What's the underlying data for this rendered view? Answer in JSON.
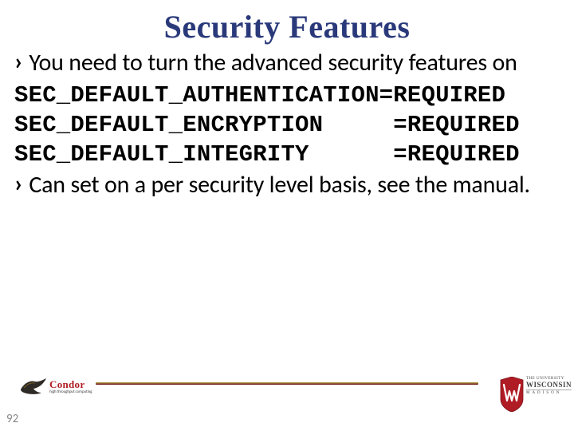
{
  "title": "Security Features",
  "bullets": [
    "You need to turn the advanced security features on",
    "Can set on a per security level basis, see the manual."
  ],
  "code": {
    "l1": "SEC_DEFAULT_AUTHENTICATION=REQUIRED",
    "l2": "SEC_DEFAULT_ENCRYPTION     =REQUIRED",
    "l3": "SEC_DEFAULT_INTEGRITY      =REQUIRED"
  },
  "footer": {
    "left_brand": "Condor",
    "left_sub": "high throughput computing",
    "right_top": "THE UNIVERSITY",
    "right_mid": "WISCONSIN",
    "right_bot": "MADISON"
  },
  "page_number": "92"
}
